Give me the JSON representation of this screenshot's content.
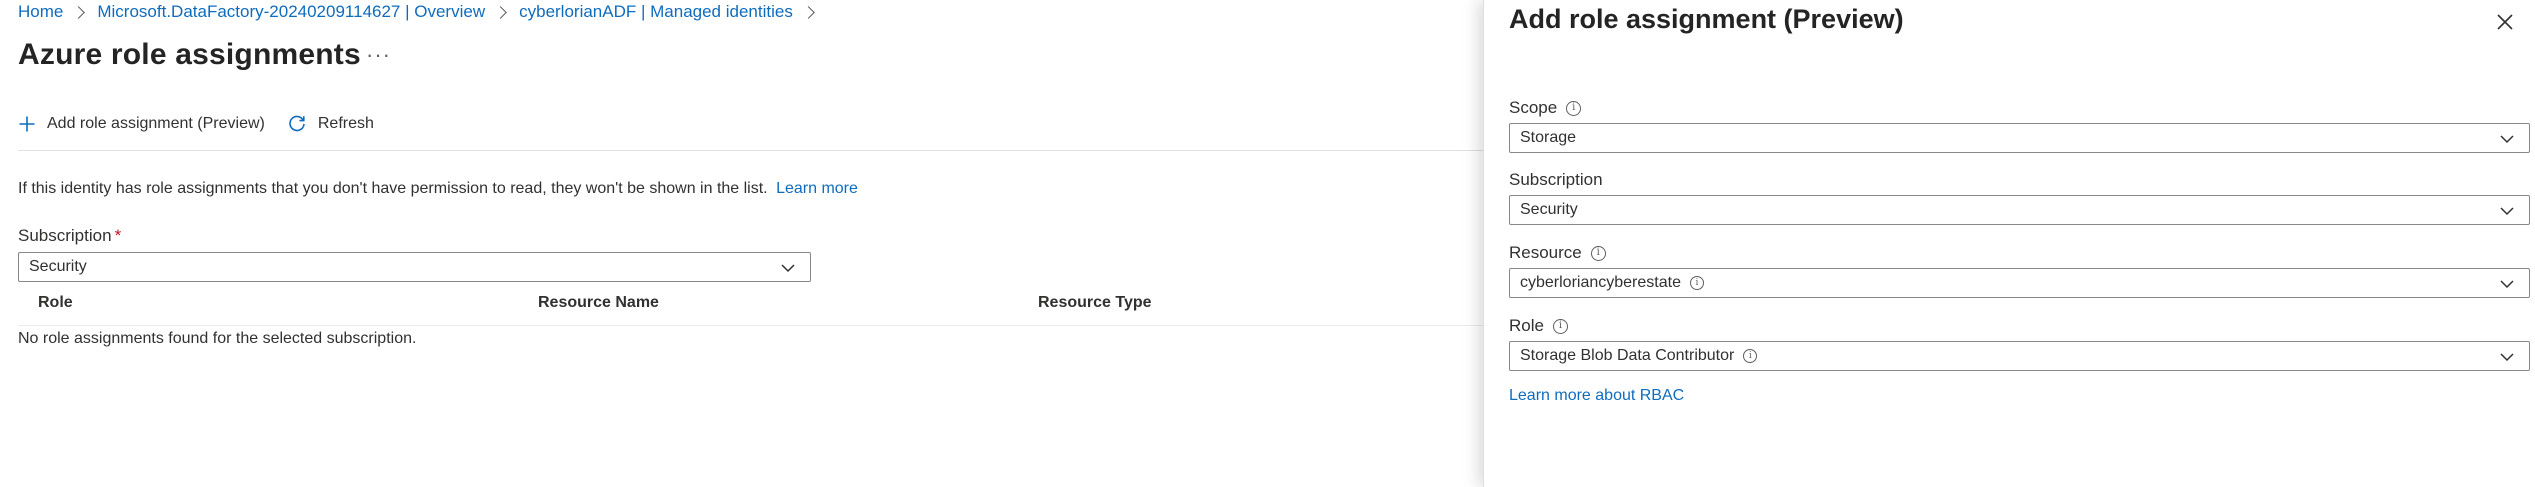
{
  "breadcrumb": {
    "items": [
      "Home",
      "Microsoft.DataFactory-20240209114627 | Overview",
      "cyberlorianADF | Managed identities"
    ]
  },
  "page": {
    "title": "Azure role assignments",
    "more": "···"
  },
  "toolbar": {
    "add_label": "Add role assignment (Preview)",
    "refresh_label": "Refresh"
  },
  "info": {
    "text": "If this identity has role assignments that you don't have permission to read, they won't be shown in the list.",
    "link": "Learn more"
  },
  "subscription": {
    "label": "Subscription",
    "required_marker": "*",
    "value": "Security"
  },
  "table": {
    "columns": [
      "Role",
      "Resource Name",
      "Resource Type"
    ],
    "empty_message": "No role assignments found for the selected subscription."
  },
  "panel": {
    "title": "Add role assignment (Preview)",
    "scope": {
      "label": "Scope",
      "value": "Storage"
    },
    "subscription": {
      "label": "Subscription",
      "value": "Security"
    },
    "resource": {
      "label": "Resource",
      "value": "cyberloriancyberestate"
    },
    "role": {
      "label": "Role",
      "value": "Storage Blob Data Contributor"
    },
    "rbac_link": "Learn more about RBAC"
  },
  "icons": {
    "add": "plus-icon",
    "refresh": "refresh-icon",
    "close": "close-icon",
    "chevron": "chevron-down-icon",
    "info": "info-icon"
  },
  "colors": {
    "link": "#0f6cbd",
    "required": "#c50f1f",
    "text": "#323130"
  }
}
